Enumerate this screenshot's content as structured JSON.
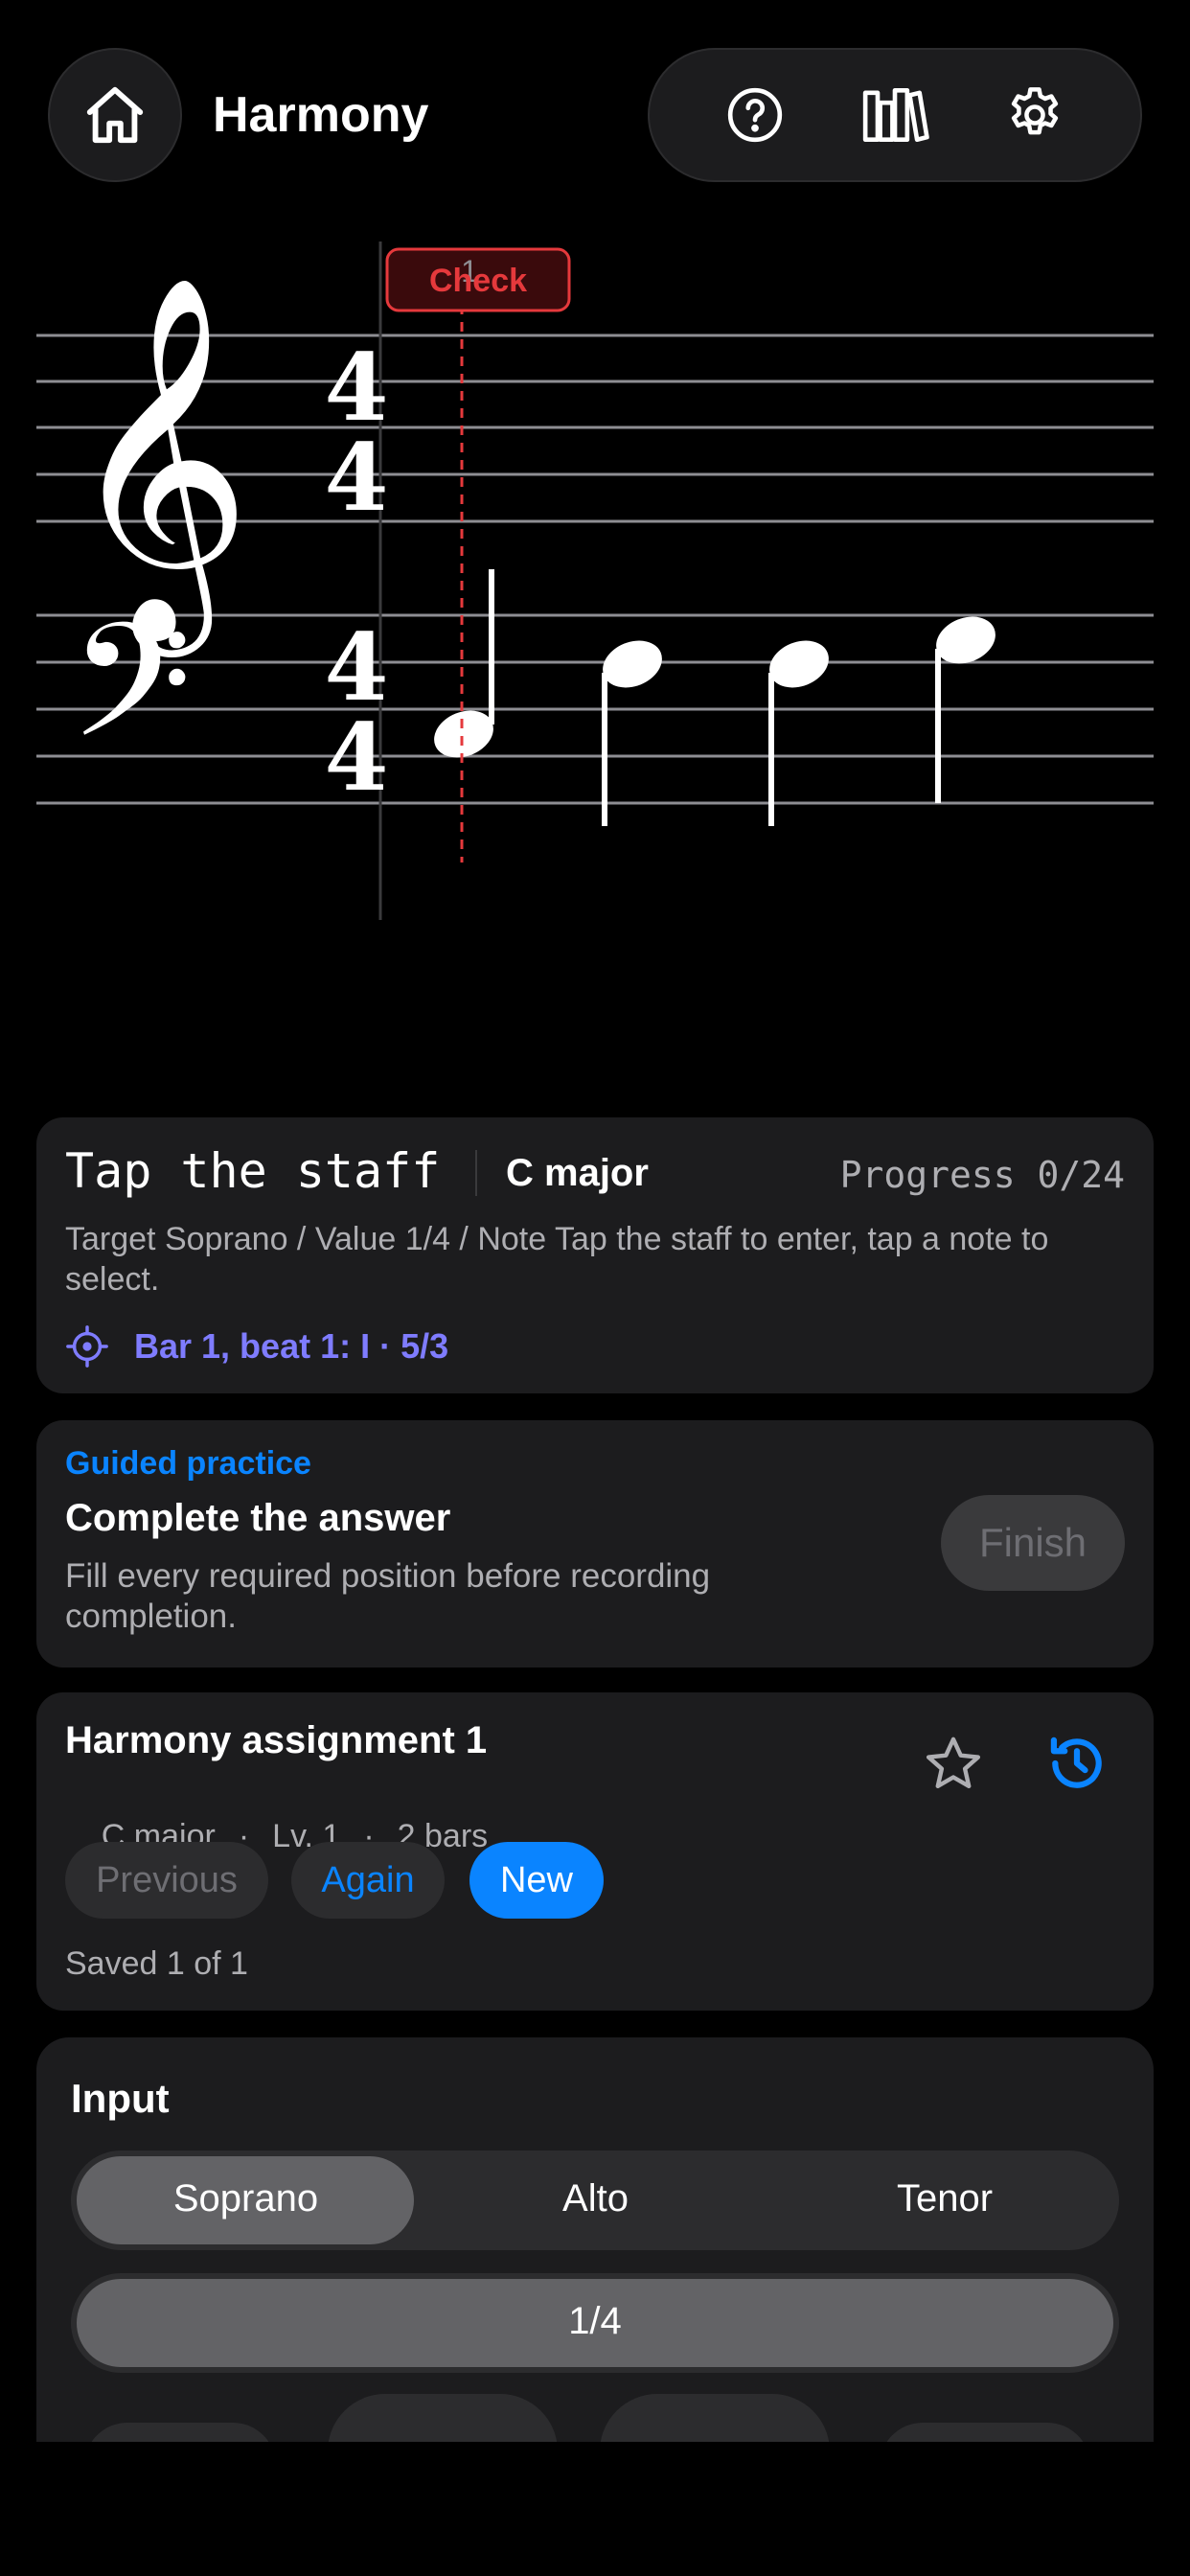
{
  "header": {
    "title": "Harmony",
    "home_icon": "home-icon"
  },
  "toolbar": {
    "help_icon": "help-icon",
    "library_icon": "library-icon",
    "settings_icon": "gear-icon"
  },
  "staff": {
    "check_label": "Check",
    "bar_number": "1",
    "time_signature_top": "4",
    "time_signature_bottom": "4"
  },
  "status": {
    "mode": "Tap the staff",
    "key": "C major",
    "progress": "Progress 0/24",
    "hint": "Target Soprano / Value 1/4 / Note  Tap the staff to enter, tap a note to select.",
    "position": "Bar 1, beat 1: I · 5/3"
  },
  "guided": {
    "kicker": "Guided practice",
    "title": "Complete the answer",
    "description": "Fill every required position before recording completion.",
    "finish_label": "Finish"
  },
  "assignment": {
    "title": "Harmony assignment 1",
    "key": "C major",
    "level": "Lv. 1",
    "bars": "2 bars",
    "separator": "·",
    "previous_label": "Previous",
    "again_label": "Again",
    "new_label": "New",
    "saved": "Saved 1 of 1"
  },
  "input": {
    "title": "Input",
    "voices": [
      "Soprano",
      "Alto",
      "Tenor"
    ],
    "selected_voice": "Soprano",
    "value": "1/4"
  },
  "colors": {
    "accent_blue": "#0a84ff",
    "accent_purple": "#7f7cff",
    "check_red": "#e5393c",
    "card_bg": "#1c1c1e"
  }
}
